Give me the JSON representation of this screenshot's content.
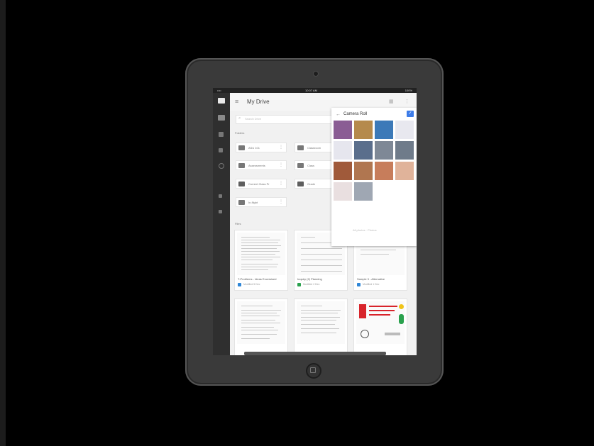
{
  "device": {
    "status_carrier": "•••• ",
    "status_time": "10:07 AM",
    "status_battery": "100%"
  },
  "topbar": {
    "title": "My Drive",
    "back_glyph": "≡",
    "sort_glyph": "⋮",
    "grid_glyph": "▦"
  },
  "search": {
    "placeholder": "Search Drive"
  },
  "sections": {
    "folders_label": "Folders",
    "files_label": "Files"
  },
  "folders": [
    {
      "name": "ASU 101",
      "shared": false
    },
    {
      "name": "Classroom",
      "shared": false
    },
    {
      "name": "Assessments",
      "shared": false
    },
    {
      "name": "Class",
      "shared": false
    },
    {
      "name": "Current Class Pr",
      "shared": true
    },
    {
      "name": "Grade",
      "shared": true
    },
    {
      "name": "In-flight",
      "shared": false
    }
  ],
  "files": [
    {
      "name": "T-Problems - Ideas Excersised",
      "meta": "Modified 5 Dec",
      "icon_color": "#2f86d7"
    },
    {
      "name": "Inquiry (2) Planning",
      "meta": "Modified 2 Dec",
      "icon_color": "#2aa14d"
    },
    {
      "name": "Sample 3 - Alternative",
      "meta": "Modified 1 Dec",
      "icon_color": "#2f86d7"
    }
  ],
  "camera_roll": {
    "title": "Camera Roll",
    "back_glyph": "←",
    "confirm_glyph": "✓",
    "hint": "All photos · Photos",
    "photos": [
      {
        "color": "#8a5d94"
      },
      {
        "color": "#b58a4d"
      },
      {
        "color": "#3c79b8"
      },
      {
        "color": "#e8e8ef"
      },
      {
        "color": "#e6e6ee"
      },
      {
        "color": "#5a6e8c"
      },
      {
        "color": "#7e8896"
      },
      {
        "color": "#6f7b8a"
      },
      {
        "color": "#a05a3a"
      },
      {
        "color": "#b07650"
      },
      {
        "color": "#c77d5b"
      },
      {
        "color": "#e0b39a"
      },
      {
        "color": "#e9dfe0"
      },
      {
        "color": "#9fa7b3"
      }
    ]
  },
  "colors": {
    "accent": "#3d7ce8",
    "rail": "#2f2f2f",
    "tablet": "#3a3a3a"
  }
}
